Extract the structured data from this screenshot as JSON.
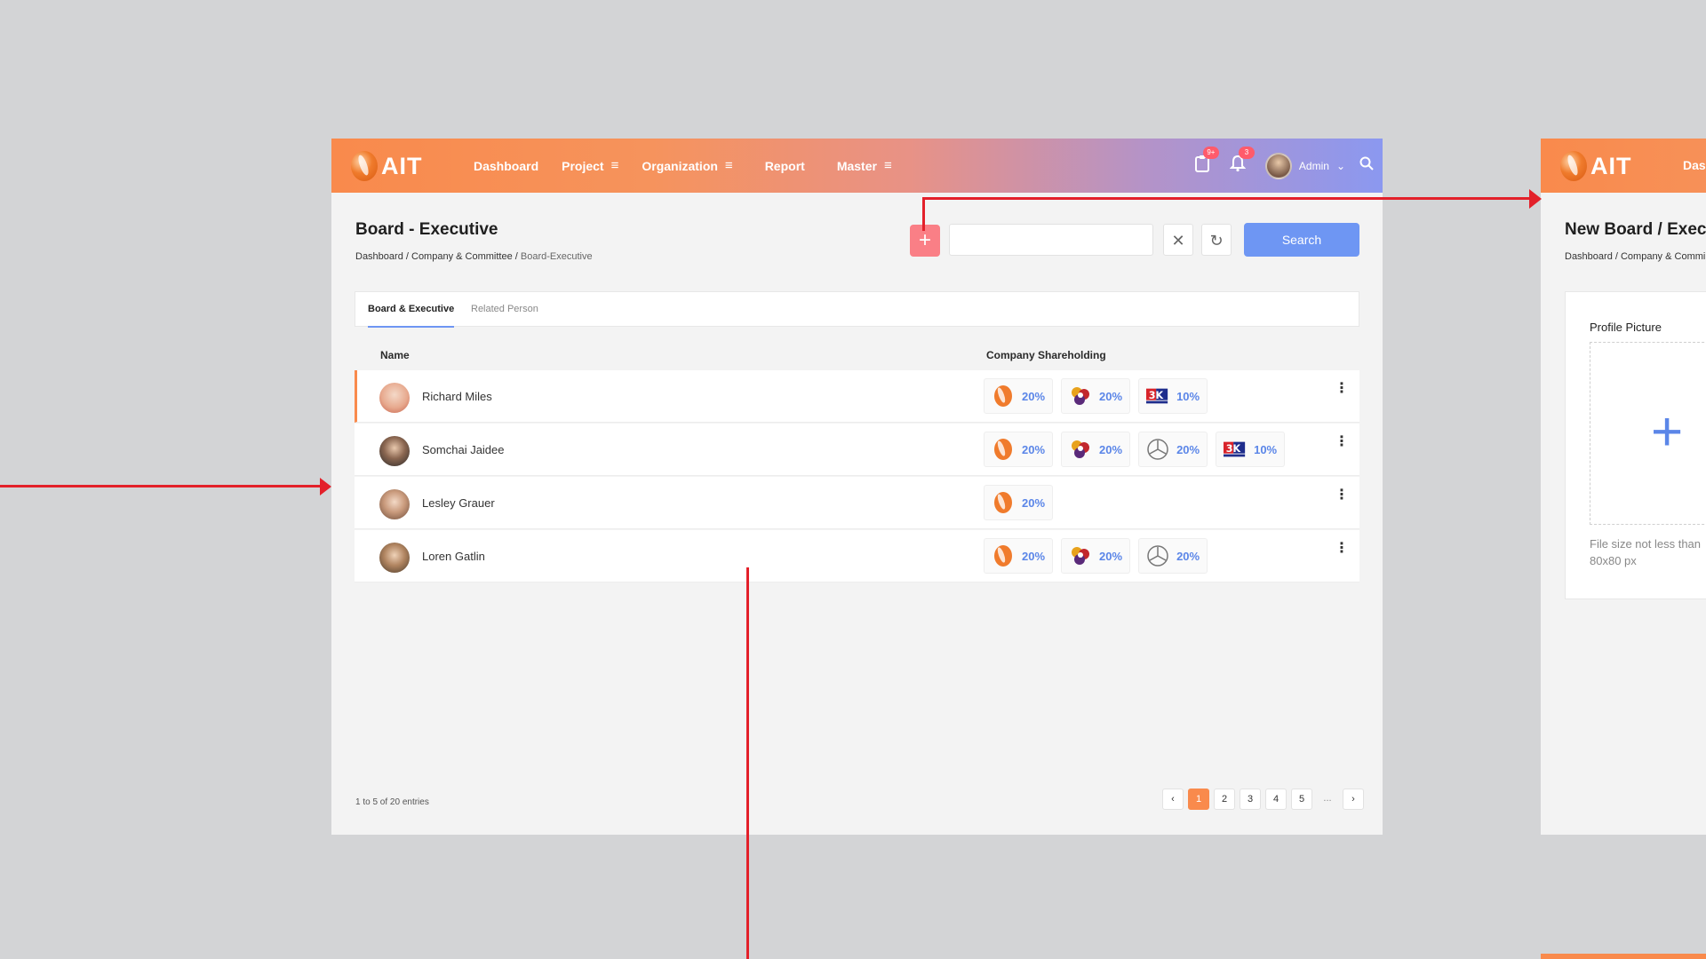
{
  "brand": {
    "logo_text": "AIT",
    "accent": "#f98a4c",
    "primary_blue": "#6e96f3"
  },
  "nav": {
    "items": [
      {
        "label": "Dashboard",
        "menu_icon": ""
      },
      {
        "label": "Project",
        "menu_icon": "≡"
      },
      {
        "label": "Organization",
        "menu_icon": "≡"
      },
      {
        "label": "Report",
        "menu_icon": ""
      },
      {
        "label": "Master",
        "menu_icon": "≡"
      }
    ]
  },
  "topbar": {
    "clipboard_badge": "9+",
    "bell_badge": "3",
    "user_name": "Admin"
  },
  "page": {
    "title": "Board - Executive",
    "breadcrumb": [
      "Dashboard",
      "Company & Committee",
      "Board-Executive"
    ]
  },
  "toolbar": {
    "add_label": "+",
    "search_value": "",
    "search_label": "Search"
  },
  "tabs": [
    "Board & Executive",
    "Related Person"
  ],
  "table": {
    "headers": {
      "name": "Name",
      "shareholding": "Company Shareholding"
    },
    "rows": [
      {
        "name": "Richard Miles",
        "holdings": [
          {
            "company": "ait-logo",
            "pct": "20%"
          },
          {
            "company": "mixed-brand-logo",
            "pct": "20%"
          },
          {
            "company": "3k-battery-logo",
            "pct": "10%"
          }
        ]
      },
      {
        "name": "Somchai Jaidee",
        "holdings": [
          {
            "company": "ait-logo",
            "pct": "20%"
          },
          {
            "company": "mixed-brand-logo",
            "pct": "20%"
          },
          {
            "company": "mercedes-logo",
            "pct": "20%"
          },
          {
            "company": "3k-battery-logo",
            "pct": "10%"
          }
        ]
      },
      {
        "name": "Lesley Grauer",
        "holdings": [
          {
            "company": "ait-logo",
            "pct": "20%"
          }
        ]
      },
      {
        "name": "Loren Gatlin",
        "holdings": [
          {
            "company": "ait-logo",
            "pct": "20%"
          },
          {
            "company": "mixed-brand-logo",
            "pct": "20%"
          },
          {
            "company": "mercedes-logo",
            "pct": "20%"
          }
        ]
      }
    ]
  },
  "footer": {
    "entries": "1 to 5 of 20 entries",
    "pages": [
      "1",
      "2",
      "3",
      "4",
      "5",
      "..."
    ],
    "current_page": "1"
  },
  "side_window": {
    "logo_text": "AIT",
    "nav_partial": "Dash",
    "title": "New Board / Execut",
    "breadcrumb": "Dashboard / Company & Commi",
    "profile_label": "Profile Picture",
    "upload_hint": "File size not less than 80x80 px"
  }
}
